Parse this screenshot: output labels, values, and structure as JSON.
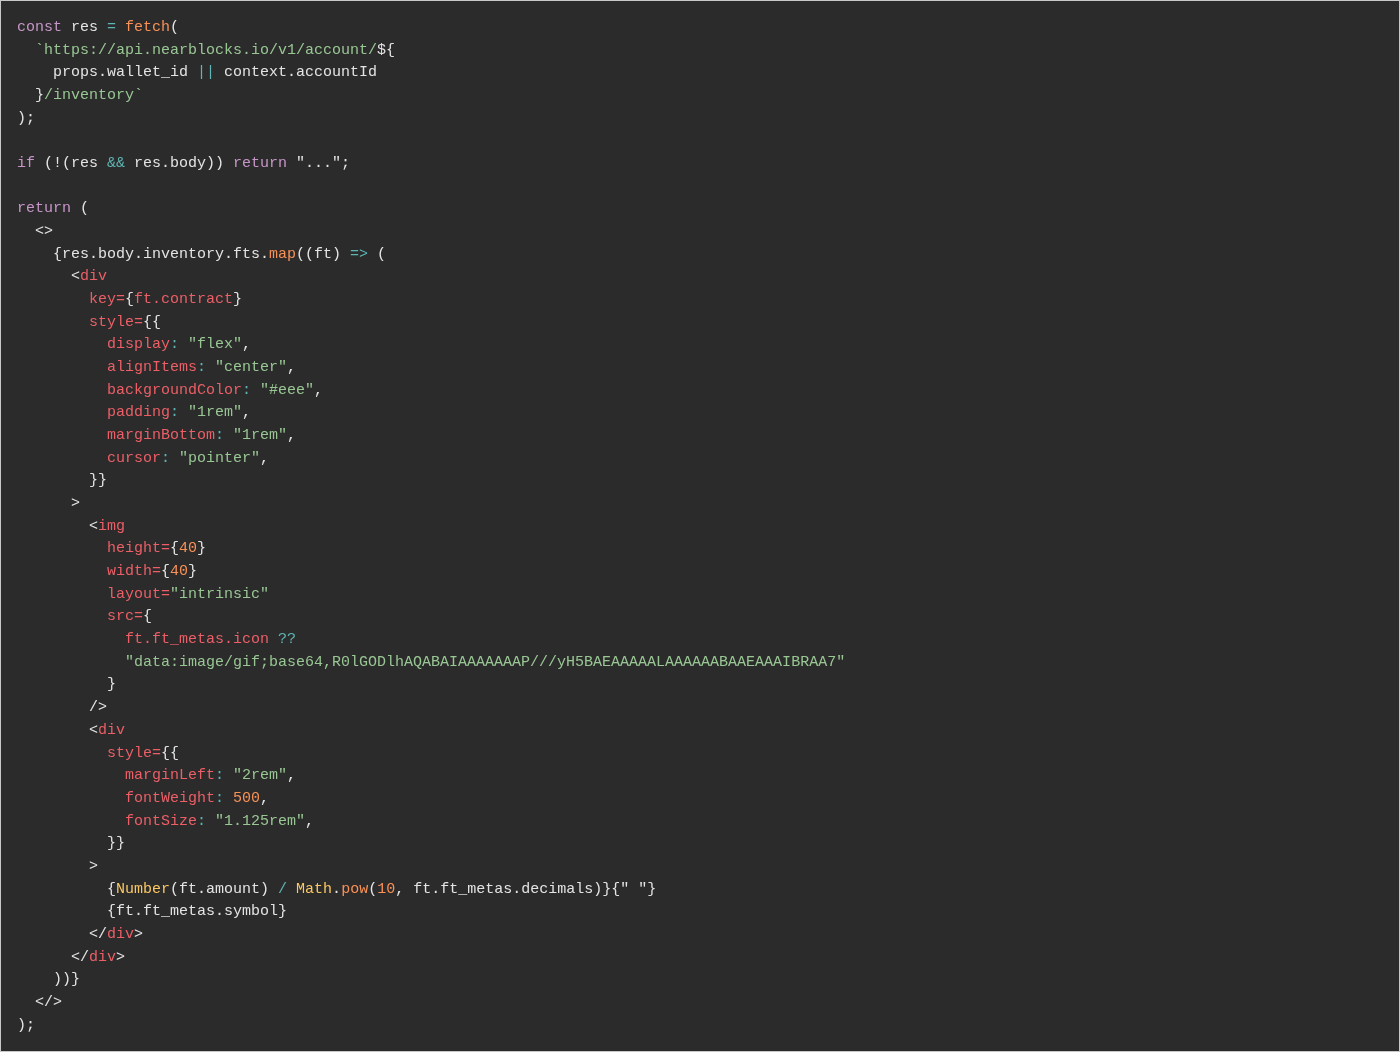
{
  "editor": {
    "lines": [
      {
        "kind": "code",
        "tokens": [
          {
            "kind": "keyword",
            "text": "const"
          },
          {
            "kind": "plain",
            "text": " res "
          },
          {
            "kind": "operator",
            "text": "= "
          },
          {
            "kind": "function",
            "text": "fetch"
          },
          {
            "kind": "plain",
            "text": "("
          }
        ]
      },
      {
        "kind": "code",
        "tokens": [
          {
            "kind": "string",
            "text": "  `https://api.nearblocks.io/v1/account/"
          },
          {
            "kind": "plain",
            "text": "${"
          }
        ]
      },
      {
        "kind": "code",
        "tokens": [
          {
            "kind": "plain",
            "text": "    props.wallet_id "
          },
          {
            "kind": "operator",
            "text": "||"
          },
          {
            "kind": "plain",
            "text": " context.accountId"
          }
        ]
      },
      {
        "kind": "code",
        "tokens": [
          {
            "kind": "plain",
            "text": "  }"
          },
          {
            "kind": "string",
            "text": "/inventory`"
          }
        ]
      },
      {
        "kind": "code",
        "tokens": [
          {
            "kind": "plain",
            "text": ");"
          }
        ]
      },
      {
        "kind": "blank"
      },
      {
        "kind": "code",
        "tokens": [
          {
            "kind": "keyword",
            "text": "if"
          },
          {
            "kind": "plain",
            "text": " (!(res "
          },
          {
            "kind": "operator",
            "text": "&&"
          },
          {
            "kind": "plain",
            "text": " res.body)) "
          },
          {
            "kind": "keyword",
            "text": "return"
          },
          {
            "kind": "plain",
            "text": " \"...\";"
          }
        ]
      },
      {
        "kind": "blank"
      },
      {
        "kind": "code",
        "tokens": [
          {
            "kind": "keyword",
            "text": "return"
          },
          {
            "kind": "plain",
            "text": " ("
          }
        ]
      },
      {
        "kind": "code",
        "tokens": [
          {
            "kind": "plain",
            "text": "  <>"
          }
        ]
      },
      {
        "kind": "code",
        "tokens": [
          {
            "kind": "plain",
            "text": "    {res.body.inventory.fts."
          },
          {
            "kind": "function",
            "text": "map"
          },
          {
            "kind": "plain",
            "text": "((ft) "
          },
          {
            "kind": "operator",
            "text": "=>"
          },
          {
            "kind": "plain",
            "text": " ("
          }
        ]
      },
      {
        "kind": "code",
        "tokens": [
          {
            "kind": "plain",
            "text": "      <"
          },
          {
            "kind": "tag",
            "text": "div"
          }
        ]
      },
      {
        "kind": "code",
        "tokens": [
          {
            "kind": "tag",
            "text": "        key="
          },
          {
            "kind": "plain",
            "text": "{"
          },
          {
            "kind": "tag",
            "text": "ft.contract"
          },
          {
            "kind": "plain",
            "text": "}"
          }
        ]
      },
      {
        "kind": "code",
        "tokens": [
          {
            "kind": "tag",
            "text": "        style="
          },
          {
            "kind": "plain",
            "text": "{{"
          }
        ]
      },
      {
        "kind": "code",
        "tokens": [
          {
            "kind": "tag",
            "text": "          display"
          },
          {
            "kind": "operator",
            "text": ": "
          },
          {
            "kind": "string",
            "text": "\"flex\""
          },
          {
            "kind": "plain",
            "text": ","
          }
        ]
      },
      {
        "kind": "code",
        "tokens": [
          {
            "kind": "tag",
            "text": "          alignItems"
          },
          {
            "kind": "operator",
            "text": ": "
          },
          {
            "kind": "string",
            "text": "\"center\""
          },
          {
            "kind": "plain",
            "text": ","
          }
        ]
      },
      {
        "kind": "code",
        "tokens": [
          {
            "kind": "tag",
            "text": "          backgroundColor"
          },
          {
            "kind": "operator",
            "text": ": "
          },
          {
            "kind": "string",
            "text": "\"#eee\""
          },
          {
            "kind": "plain",
            "text": ","
          }
        ]
      },
      {
        "kind": "code",
        "tokens": [
          {
            "kind": "tag",
            "text": "          padding"
          },
          {
            "kind": "operator",
            "text": ": "
          },
          {
            "kind": "string",
            "text": "\"1rem\""
          },
          {
            "kind": "plain",
            "text": ","
          }
        ]
      },
      {
        "kind": "code",
        "tokens": [
          {
            "kind": "tag",
            "text": "          marginBottom"
          },
          {
            "kind": "operator",
            "text": ": "
          },
          {
            "kind": "string",
            "text": "\"1rem\""
          },
          {
            "kind": "plain",
            "text": ","
          }
        ]
      },
      {
        "kind": "code",
        "tokens": [
          {
            "kind": "tag",
            "text": "          cursor"
          },
          {
            "kind": "operator",
            "text": ": "
          },
          {
            "kind": "string",
            "text": "\"pointer\""
          },
          {
            "kind": "plain",
            "text": ","
          }
        ]
      },
      {
        "kind": "code",
        "tokens": [
          {
            "kind": "plain",
            "text": "        }}"
          }
        ]
      },
      {
        "kind": "code",
        "tokens": [
          {
            "kind": "plain",
            "text": "      >"
          }
        ]
      },
      {
        "kind": "code",
        "tokens": [
          {
            "kind": "plain",
            "text": "        <"
          },
          {
            "kind": "tag",
            "text": "img"
          }
        ]
      },
      {
        "kind": "code",
        "tokens": [
          {
            "kind": "tag",
            "text": "          height="
          },
          {
            "kind": "plain",
            "text": "{"
          },
          {
            "kind": "function",
            "text": "40"
          },
          {
            "kind": "plain",
            "text": "}"
          }
        ]
      },
      {
        "kind": "code",
        "tokens": [
          {
            "kind": "tag",
            "text": "          width="
          },
          {
            "kind": "plain",
            "text": "{"
          },
          {
            "kind": "function",
            "text": "40"
          },
          {
            "kind": "plain",
            "text": "}"
          }
        ]
      },
      {
        "kind": "code",
        "tokens": [
          {
            "kind": "tag",
            "text": "          layout="
          },
          {
            "kind": "string",
            "text": "\"intrinsic\""
          }
        ]
      },
      {
        "kind": "code",
        "tokens": [
          {
            "kind": "tag",
            "text": "          src="
          },
          {
            "kind": "plain",
            "text": "{"
          }
        ]
      },
      {
        "kind": "code",
        "tokens": [
          {
            "kind": "tag",
            "text": "            ft.ft_metas.icon "
          },
          {
            "kind": "operator",
            "text": "??"
          }
        ]
      },
      {
        "kind": "code",
        "tokens": [
          {
            "kind": "string",
            "text": "            \"data:image/gif;base64,R0lGODlhAQABAIAAAAAAAP///yH5BAEAAAAALAAAAAABAAEAAAIBRAA7\""
          }
        ]
      },
      {
        "kind": "code",
        "tokens": [
          {
            "kind": "plain",
            "text": "          }"
          }
        ]
      },
      {
        "kind": "code",
        "tokens": [
          {
            "kind": "plain",
            "text": "        />"
          }
        ]
      },
      {
        "kind": "code",
        "tokens": [
          {
            "kind": "plain",
            "text": "        <"
          },
          {
            "kind": "tag",
            "text": "div"
          }
        ]
      },
      {
        "kind": "code",
        "tokens": [
          {
            "kind": "tag",
            "text": "          style="
          },
          {
            "kind": "plain",
            "text": "{{"
          }
        ]
      },
      {
        "kind": "code",
        "tokens": [
          {
            "kind": "tag",
            "text": "            marginLeft"
          },
          {
            "kind": "operator",
            "text": ": "
          },
          {
            "kind": "string",
            "text": "\"2rem\""
          },
          {
            "kind": "plain",
            "text": ","
          }
        ]
      },
      {
        "kind": "code",
        "tokens": [
          {
            "kind": "tag",
            "text": "            fontWeight"
          },
          {
            "kind": "operator",
            "text": ": "
          },
          {
            "kind": "function",
            "text": "500"
          },
          {
            "kind": "plain",
            "text": ","
          }
        ]
      },
      {
        "kind": "code",
        "tokens": [
          {
            "kind": "tag",
            "text": "            fontSize"
          },
          {
            "kind": "operator",
            "text": ": "
          },
          {
            "kind": "string",
            "text": "\"1.125rem\""
          },
          {
            "kind": "plain",
            "text": ","
          }
        ]
      },
      {
        "kind": "code",
        "tokens": [
          {
            "kind": "plain",
            "text": "          }}"
          }
        ]
      },
      {
        "kind": "code",
        "tokens": [
          {
            "kind": "plain",
            "text": "        >"
          }
        ]
      },
      {
        "kind": "code",
        "tokens": [
          {
            "kind": "plain",
            "text": "          {"
          },
          {
            "kind": "class",
            "text": "Number"
          },
          {
            "kind": "plain",
            "text": "(ft.amount) "
          },
          {
            "kind": "operator",
            "text": "/ "
          },
          {
            "kind": "class",
            "text": "Math"
          },
          {
            "kind": "plain",
            "text": "."
          },
          {
            "kind": "function",
            "text": "pow"
          },
          {
            "kind": "plain",
            "text": "("
          },
          {
            "kind": "function",
            "text": "10"
          },
          {
            "kind": "plain",
            "text": ", ft.ft_metas.decimals)}{\" \"}"
          }
        ]
      },
      {
        "kind": "code",
        "tokens": [
          {
            "kind": "plain",
            "text": "          {ft.ft_metas.symbol}"
          }
        ]
      },
      {
        "kind": "code",
        "tokens": [
          {
            "kind": "plain",
            "text": "        </"
          },
          {
            "kind": "tag",
            "text": "div"
          },
          {
            "kind": "plain",
            "text": ">"
          }
        ]
      },
      {
        "kind": "code",
        "tokens": [
          {
            "kind": "plain",
            "text": "      </"
          },
          {
            "kind": "tag",
            "text": "div"
          },
          {
            "kind": "plain",
            "text": ">"
          }
        ]
      },
      {
        "kind": "code",
        "tokens": [
          {
            "kind": "plain",
            "text": "    ))}"
          }
        ]
      },
      {
        "kind": "code",
        "tokens": [
          {
            "kind": "plain",
            "text": "  </>"
          }
        ]
      },
      {
        "kind": "code",
        "tokens": [
          {
            "kind": "plain",
            "text": ");"
          }
        ]
      }
    ]
  }
}
